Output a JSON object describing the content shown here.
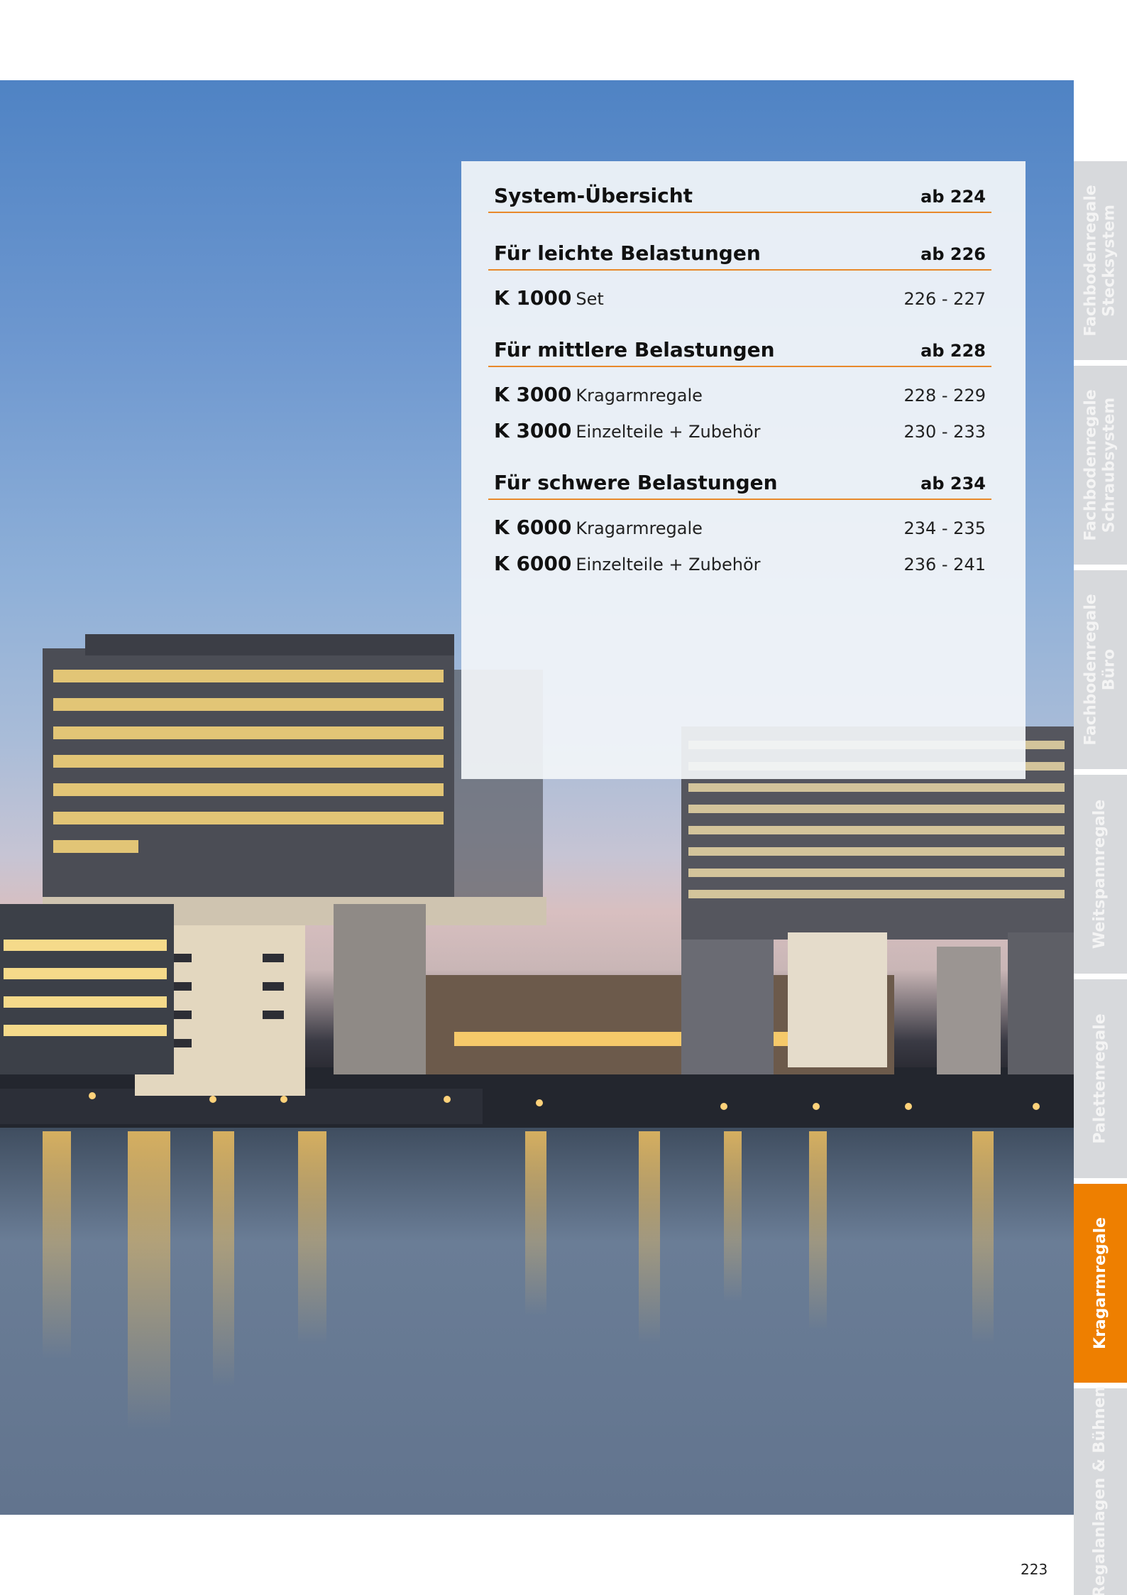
{
  "toc": {
    "sections": [
      {
        "title": "System-Übersicht",
        "page": "ab 224",
        "items": []
      },
      {
        "title": "Für leichte Belastungen",
        "page": "ab 226",
        "items": [
          {
            "code": "K 1000",
            "desc": "Set",
            "pages": "226 - 227"
          }
        ]
      },
      {
        "title": "Für mittlere Belastungen",
        "page": "ab 228",
        "items": [
          {
            "code": "K 3000",
            "desc": "Kragarmregale",
            "pages": "228 - 229"
          },
          {
            "code": "K 3000",
            "desc": "Einzelteile + Zubehör",
            "pages": "230 - 233"
          }
        ]
      },
      {
        "title": "Für schwere Belastungen",
        "page": "ab 234",
        "items": [
          {
            "code": "K 6000",
            "desc": "Kragarmregale",
            "pages": "234 - 235"
          },
          {
            "code": "K 6000",
            "desc": "Einzelteile + Zubehör",
            "pages": "236 - 241"
          }
        ]
      }
    ]
  },
  "tabs": [
    {
      "line1": "Fachbodenregale",
      "line2": "Stecksystem",
      "active": false
    },
    {
      "line1": "Fachbodenregale",
      "line2": "Schraubsystem",
      "active": false
    },
    {
      "line1": "Fachbodenregale",
      "line2": "Büro",
      "active": false
    },
    {
      "line1": "Weitspannregale",
      "line2": "",
      "active": false
    },
    {
      "line1": "Palettenregale",
      "line2": "",
      "active": false
    },
    {
      "line1": "Kragarmregale",
      "line2": "",
      "active": true
    },
    {
      "line1": "Regalanlagen & Bühnen",
      "line2": "",
      "active": false
    }
  ],
  "colors": {
    "accent": "#ee7f00",
    "tab_inactive": "#d7d9dc",
    "rule": "#e8892a"
  },
  "page_number": "223"
}
